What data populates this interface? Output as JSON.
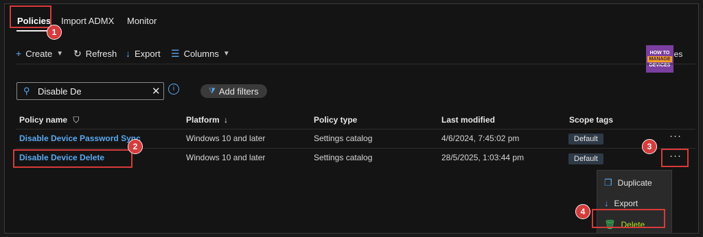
{
  "tabs": [
    "Policies",
    "Import ADMX",
    "Monitor"
  ],
  "toolbar": {
    "create": "Create",
    "refresh": "Refresh",
    "export": "Export",
    "columns": "Columns",
    "right_text": "cies"
  },
  "logo": {
    "line1": "HOW TO",
    "line2": "MANAGE",
    "line3": "DEVICES"
  },
  "search": {
    "value": "Disable De"
  },
  "filters": {
    "add": "Add filters"
  },
  "table": {
    "headers": [
      "Policy name",
      "Platform",
      "Policy type",
      "Last modified",
      "Scope tags"
    ],
    "rows": [
      {
        "name": "Disable Device Password Sync",
        "platform": "Windows 10 and later",
        "type": "Settings catalog",
        "modified": "4/6/2024, 7:45:02 pm",
        "scope": "Default"
      },
      {
        "name": "Disable Device Delete",
        "platform": "Windows 10 and later",
        "type": "Settings catalog",
        "modified": "28/5/2025, 1:03:44 pm",
        "scope": "Default"
      }
    ]
  },
  "context_menu": [
    "Duplicate",
    "Export",
    "Delete"
  ],
  "badges": [
    "1",
    "2",
    "3",
    "4"
  ],
  "colors": {
    "accent": "#5aa9f0",
    "highlight": "#d93a3a",
    "delete": "#b5e61d"
  }
}
